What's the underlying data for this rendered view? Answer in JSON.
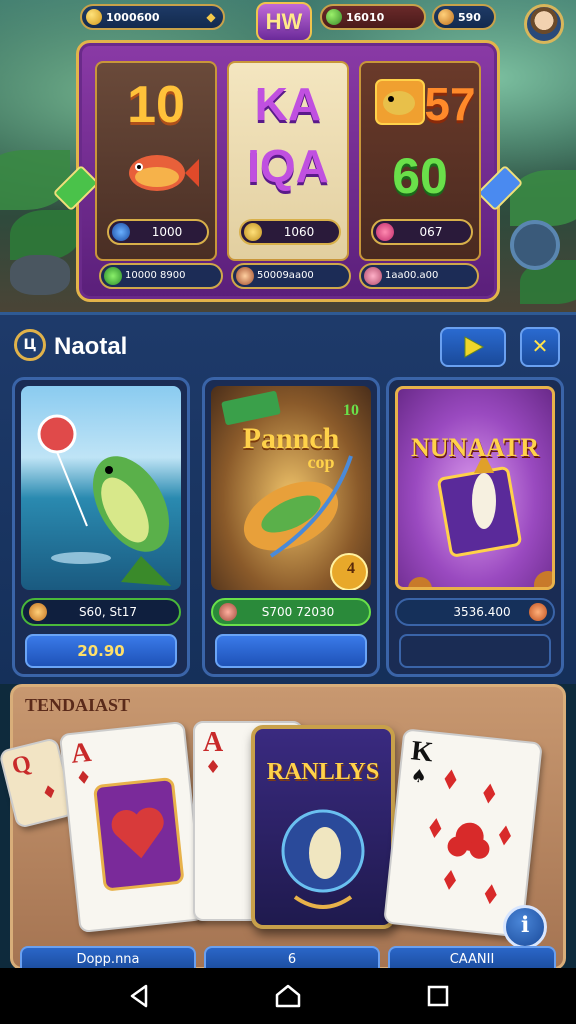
{
  "topbar": {
    "balance_1": "1000600",
    "logo": "HW",
    "balance_2": "16010",
    "balance_3": "590"
  },
  "slot": {
    "reels": [
      {
        "title_top": "10",
        "value": "1000"
      },
      {
        "title_top": "KA",
        "title_bottom": "IQA",
        "value": "1060"
      },
      {
        "title_top": "57",
        "title_bottom": "60",
        "value": "067"
      }
    ],
    "bottom": [
      "10000 8900",
      "50009aa00",
      "1aa00.a00"
    ]
  },
  "panel": {
    "title": "Naotal",
    "play_icon": "play-icon",
    "close_icon": "close-icon",
    "cards": [
      {
        "value": "S60, St17",
        "button": "20.90"
      },
      {
        "art_title_1": "Pannch",
        "art_title_2": "cop",
        "badge": "10",
        "coin": "4",
        "value": "S700 72030",
        "button": ""
      },
      {
        "art_title": "NUNAATR",
        "value": "3536.400",
        "button": ""
      }
    ]
  },
  "table": {
    "title": "TENDAIAST",
    "cards": [
      {
        "rank": "Q"
      },
      {
        "rank": "A"
      },
      {
        "rank": "A"
      },
      {
        "rank": "K"
      }
    ],
    "feature_title": "RANLLYS",
    "info_icon": "info-icon",
    "bottom_buttons": [
      "Dopp.nna",
      "6",
      "CAANII"
    ]
  },
  "colors": {
    "gold": "#e0b24a",
    "panel_blue": "#1e3a6a",
    "table_brown": "#b5835e",
    "green_value": "#49b83a"
  }
}
